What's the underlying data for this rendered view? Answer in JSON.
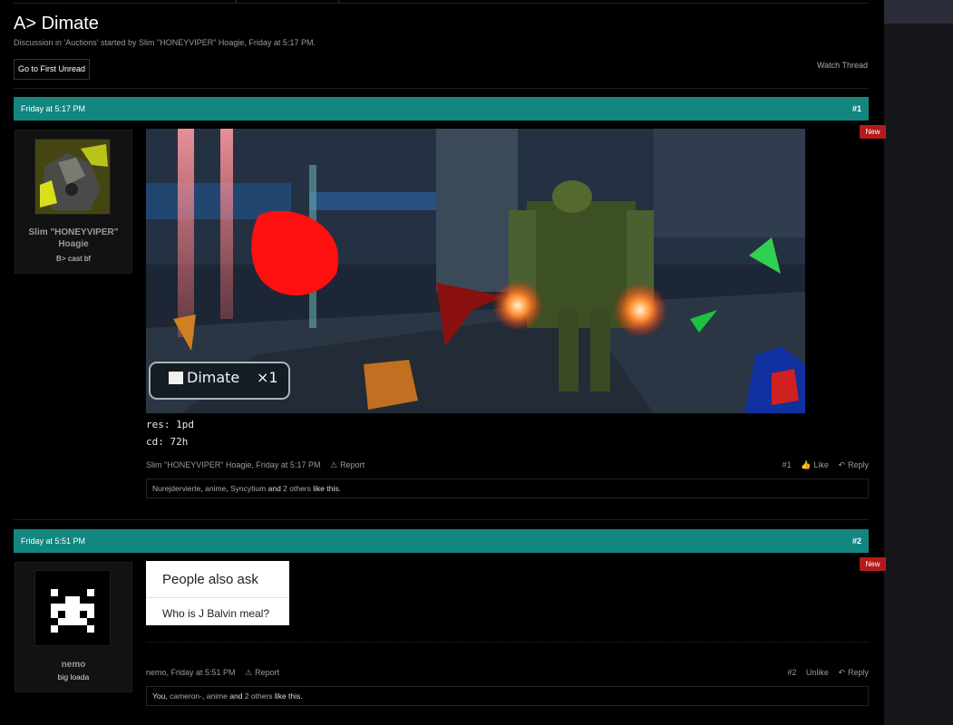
{
  "thread": {
    "title": "A> Dimate",
    "meta": "Discussion in 'Auctions' started by Slim \"HONEYVIPER\" Hoagie, Friday at 5:17 PM.",
    "first_unread_label": "Go to First Unread",
    "watch_label": "Watch Thread"
  },
  "new_badge": "New",
  "posts": [
    {
      "date": "Friday at 5:17 PM",
      "number": "#1",
      "user": {
        "name": "Slim \"HONEYVIPER\" Hoagie",
        "title": "B> cast bf"
      },
      "image_overlay": {
        "item": "Dimate",
        "qty": "×1"
      },
      "lines": [
        "res: 1pd",
        "cd: 72h"
      ],
      "footer": {
        "author_date": "Slim \"HONEYVIPER\" Hoagie, Friday at 5:17 PM",
        "report": "Report",
        "num": "#1",
        "like": "Like",
        "reply": "Reply"
      },
      "likes": {
        "names": [
          "Nurejdervierte",
          "anime",
          "Syncytium"
        ],
        "and": "and",
        "others": "2 others",
        "suffix": "like this."
      }
    },
    {
      "date": "Friday at 5:51 PM",
      "number": "#2",
      "user": {
        "name": "nemo",
        "title": "big loada"
      },
      "search_card": {
        "heading": "People also ask",
        "question": "Who is J Balvin meal?"
      },
      "footer": {
        "author_date": "nemo, Friday at 5:51 PM",
        "report": "Report",
        "num": "#2",
        "like": "Unlike",
        "reply": "Reply"
      },
      "likes": {
        "you": "You,",
        "names": [
          "cameron-",
          "anime"
        ],
        "and": "and",
        "others": "2 others",
        "suffix": "like this."
      }
    }
  ],
  "colors": {
    "header": "#138680",
    "badge": "#b31b1b",
    "background": "#000000"
  },
  "icons": [
    "warning-icon",
    "thumbs-up-icon",
    "reply-icon"
  ]
}
